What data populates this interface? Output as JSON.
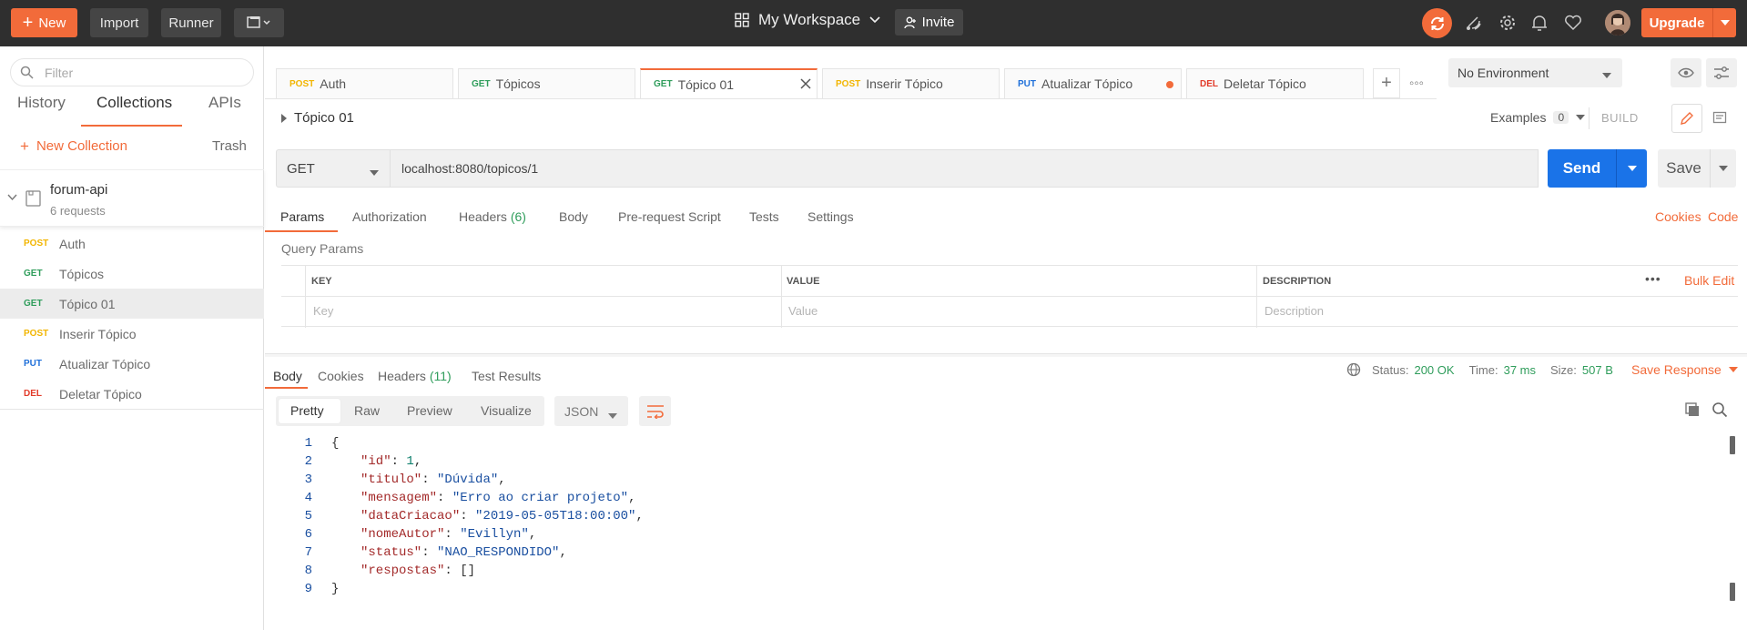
{
  "topbar": {
    "new_label": "New",
    "import_label": "Import",
    "runner_label": "Runner",
    "workspace_label": "My Workspace",
    "invite_label": "Invite",
    "upgrade_label": "Upgrade",
    "accent_color": "#f26b3a"
  },
  "sidebar": {
    "filter_placeholder": "Filter",
    "tabs": [
      {
        "label": "History"
      },
      {
        "label": "Collections",
        "active": true
      },
      {
        "label": "APIs"
      }
    ],
    "new_collection_label": "New Collection",
    "trash_label": "Trash",
    "collection": {
      "name": "forum-api",
      "count": "6 requests"
    },
    "requests": [
      {
        "method": "POST",
        "name": "Auth"
      },
      {
        "method": "GET",
        "name": "Tópicos"
      },
      {
        "method": "GET",
        "name": "Tópico 01",
        "selected": true
      },
      {
        "method": "POST",
        "name": "Inserir Tópico"
      },
      {
        "method": "PUT",
        "name": "Atualizar Tópico"
      },
      {
        "method": "DEL",
        "name": "Deletar Tópico"
      }
    ]
  },
  "tabs": [
    {
      "method": "POST",
      "name": "Auth"
    },
    {
      "method": "GET",
      "name": "Tópicos"
    },
    {
      "method": "GET",
      "name": "Tópico 01",
      "active": true
    },
    {
      "method": "POST",
      "name": "Inserir Tópico"
    },
    {
      "method": "PUT",
      "name": "Atualizar Tópico",
      "unsaved": true
    },
    {
      "method": "DEL",
      "name": "Deletar Tópico"
    }
  ],
  "environment": {
    "selected": "No Environment"
  },
  "request": {
    "title": "Tópico 01",
    "examples_label": "Examples",
    "examples_count": "0",
    "build_label": "BUILD",
    "method": "GET",
    "url": "localhost:8080/topicos/1",
    "send_label": "Send",
    "save_label": "Save",
    "tabs": [
      {
        "label": "Params",
        "active": true
      },
      {
        "label": "Authorization"
      },
      {
        "label": "Headers",
        "count": "(6)"
      },
      {
        "label": "Body"
      },
      {
        "label": "Pre-request Script"
      },
      {
        "label": "Tests"
      },
      {
        "label": "Settings"
      }
    ],
    "cookies_label": "Cookies",
    "code_label": "Code",
    "query_params_label": "Query Params",
    "columns": {
      "key": "KEY",
      "value": "VALUE",
      "description": "DESCRIPTION"
    },
    "placeholders": {
      "key": "Key",
      "value": "Value",
      "description": "Description"
    },
    "bulk_edit_label": "Bulk Edit"
  },
  "response": {
    "tabs": [
      {
        "label": "Body",
        "active": true
      },
      {
        "label": "Cookies"
      },
      {
        "label": "Headers",
        "count": "(11)"
      },
      {
        "label": "Test Results"
      }
    ],
    "status_label": "Status:",
    "status_value": "200 OK",
    "time_label": "Time:",
    "time_value": "37 ms",
    "size_label": "Size:",
    "size_value": "507 B",
    "save_response_label": "Save Response",
    "format_tabs": [
      "Pretty",
      "Raw",
      "Preview",
      "Visualize"
    ],
    "language": "JSON",
    "lines": [
      {
        "no": "1",
        "text": "{"
      },
      {
        "no": "2",
        "key": "\"id\"",
        "val": "1",
        "type": "num",
        "comma": true
      },
      {
        "no": "3",
        "key": "\"titulo\"",
        "val": "\"Dúvida\"",
        "type": "str",
        "comma": true
      },
      {
        "no": "4",
        "key": "\"mensagem\"",
        "val": "\"Erro ao criar projeto\"",
        "type": "str",
        "comma": true
      },
      {
        "no": "5",
        "key": "\"dataCriacao\"",
        "val": "\"2019-05-05T18:00:00\"",
        "type": "str",
        "comma": true
      },
      {
        "no": "6",
        "key": "\"nomeAutor\"",
        "val": "\"Evillyn\"",
        "type": "str",
        "comma": true
      },
      {
        "no": "7",
        "key": "\"status\"",
        "val": "\"NAO_RESPONDIDO\"",
        "type": "str",
        "comma": true
      },
      {
        "no": "8",
        "key": "\"respostas\"",
        "val": "[]",
        "type": "plain",
        "comma": false
      },
      {
        "no": "9",
        "text": "}"
      }
    ]
  }
}
